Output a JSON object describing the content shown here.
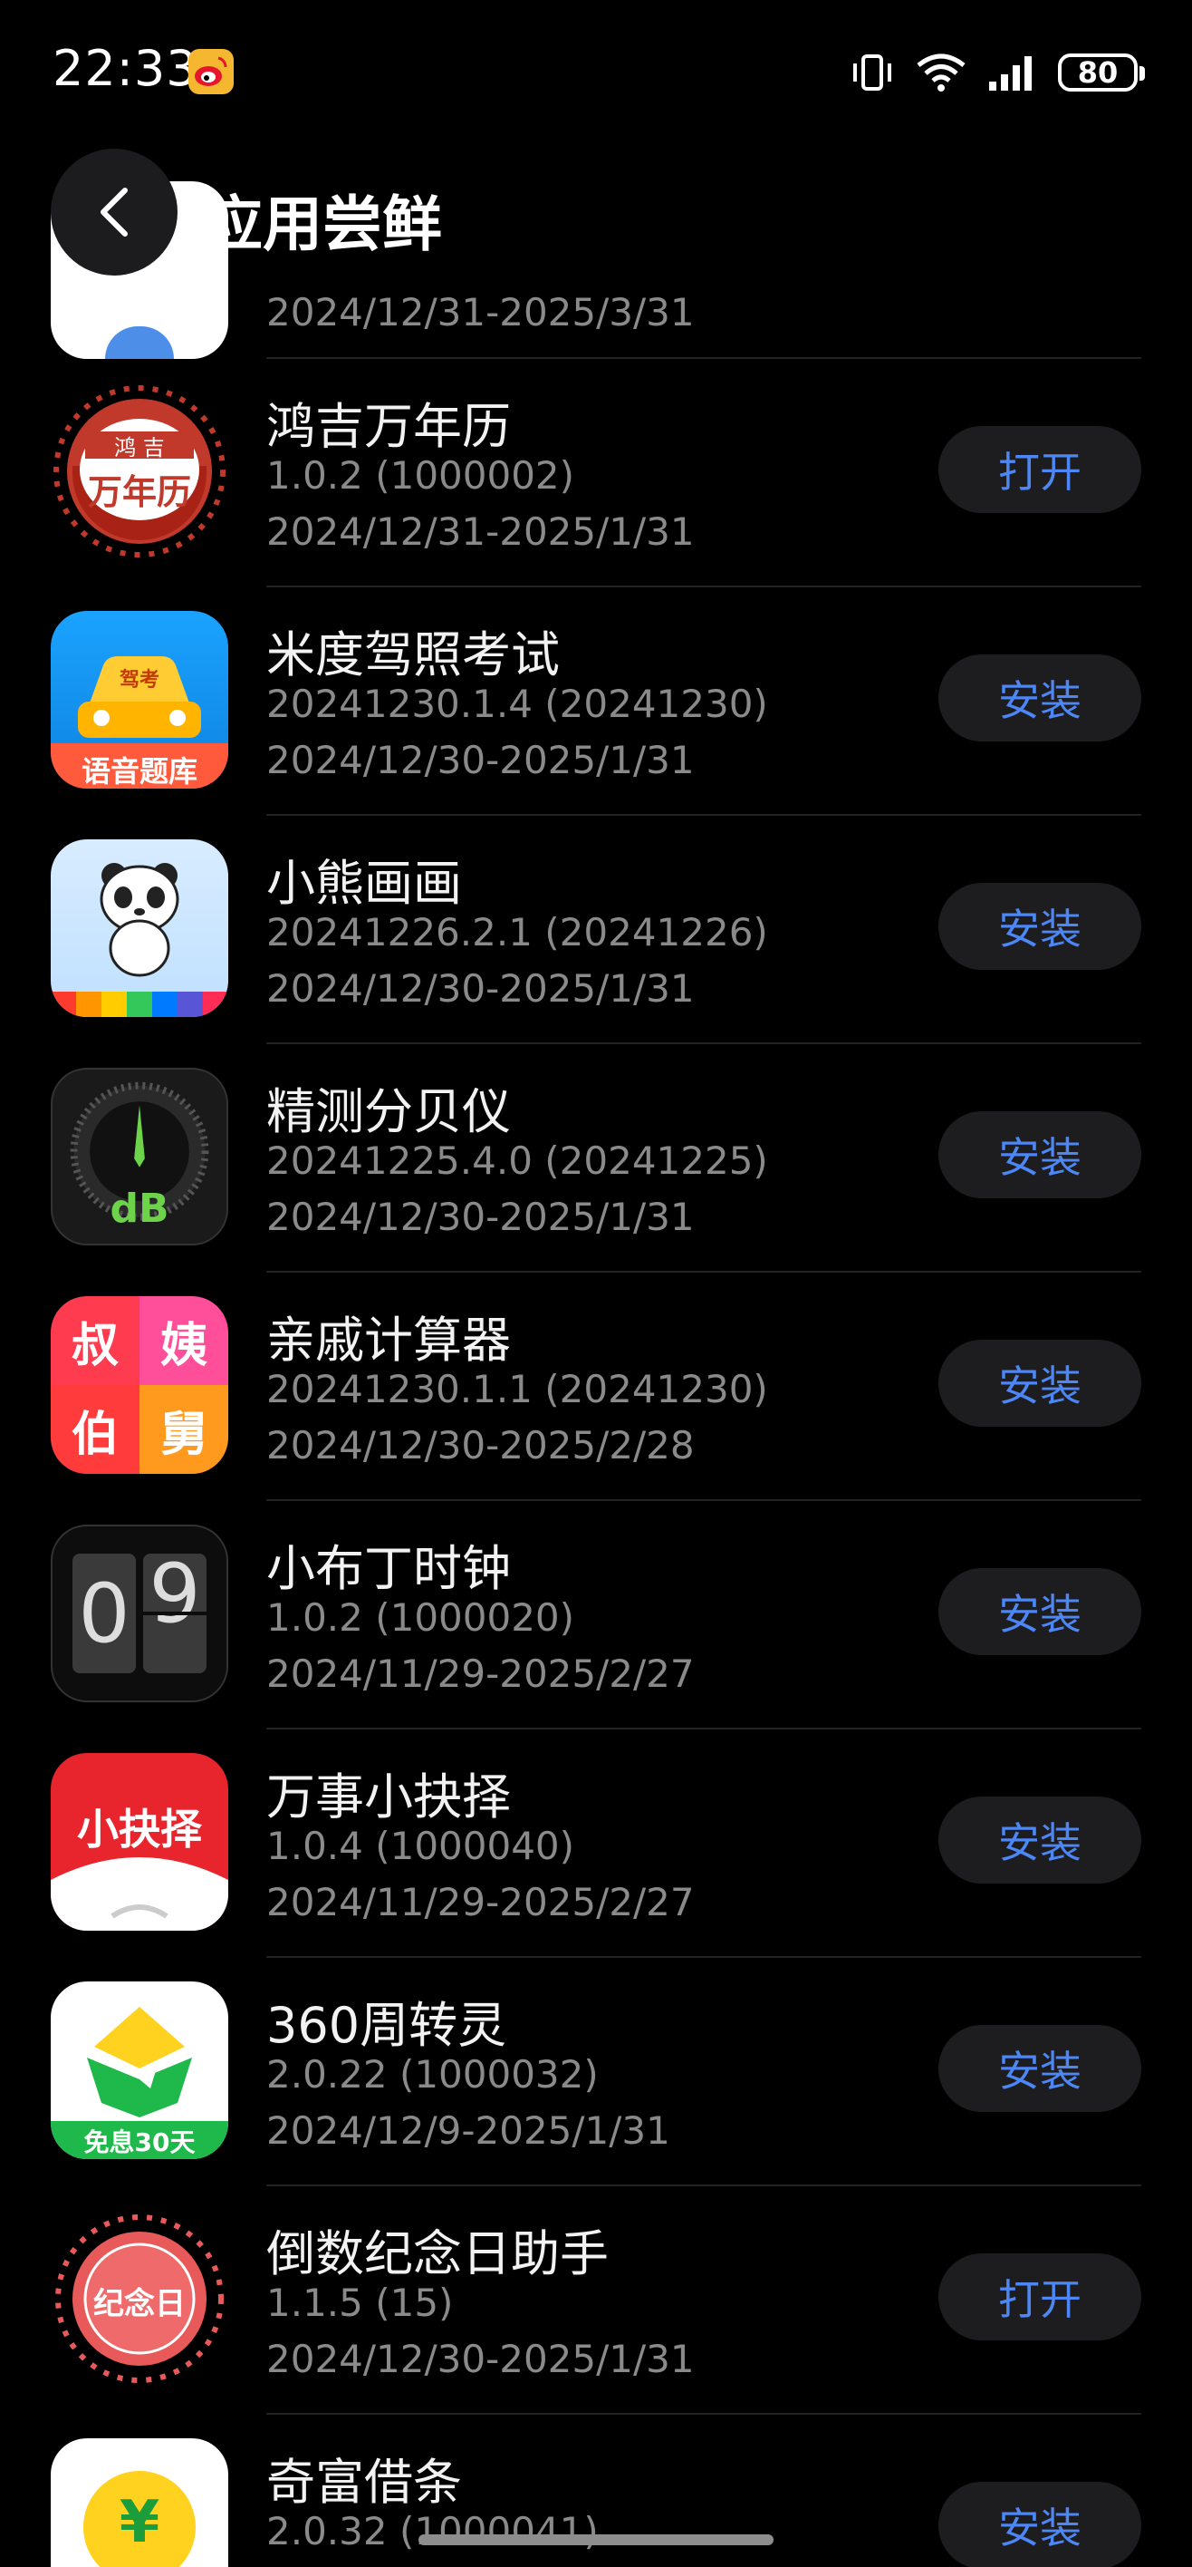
{
  "status_bar": {
    "time": "22:33",
    "battery": "80",
    "icons": [
      "weibo-icon",
      "vibrate-icon",
      "wifi-icon",
      "signal-icon",
      "battery-icon"
    ]
  },
  "header": {
    "title": "应用尝鲜",
    "back_icon": "chevron-left-icon"
  },
  "partial_top": {
    "dates": "2024/12/31-2025/3/31"
  },
  "apps": [
    {
      "name": "鸿吉万年历",
      "version": "1.0.2 (1000002)",
      "dates": "2024/12/31-2025/1/31",
      "action": "打开",
      "icon_text": "万年历",
      "icon_sub": "鸿 吉"
    },
    {
      "name": "米度驾照考试",
      "version": "20241230.1.4 (20241230)",
      "dates": "2024/12/30-2025/1/31",
      "action": "安装",
      "icon_text": "语音题库",
      "icon_sub": "驾考"
    },
    {
      "name": "小熊画画",
      "version": "20241226.2.1 (20241226)",
      "dates": "2024/12/30-2025/1/31",
      "action": "安装"
    },
    {
      "name": "精测分贝仪",
      "version": "20241225.4.0 (20241225)",
      "dates": "2024/12/30-2025/1/31",
      "action": "安装",
      "icon_text": "dB"
    },
    {
      "name": "亲戚计算器",
      "version": "20241230.1.1 (20241230)",
      "dates": "2024/12/30-2025/2/28",
      "action": "安装",
      "icon_tiles": [
        "叔",
        "姨",
        "伯",
        "舅"
      ]
    },
    {
      "name": "小布丁时钟",
      "version": "1.0.2 (1000020)",
      "dates": "2024/11/29-2025/2/27",
      "action": "安装",
      "icon_digits": [
        "0",
        "9"
      ]
    },
    {
      "name": "万事小抉择",
      "version": "1.0.4 (1000040)",
      "dates": "2024/11/29-2025/2/27",
      "action": "安装",
      "icon_text": "小抉择"
    },
    {
      "name": "360周转灵",
      "version": "2.0.22 (1000032)",
      "dates": "2024/12/9-2025/1/31",
      "action": "安装",
      "icon_text": "免息30天"
    },
    {
      "name": "倒数纪念日助手",
      "version": "1.1.5 (15)",
      "dates": "2024/12/30-2025/1/31",
      "action": "打开",
      "icon_text": "纪念日"
    },
    {
      "name": "奇富借条",
      "version": "2.0.32 (1000041)",
      "dates": "",
      "action": "安装",
      "icon_text": "¥"
    }
  ],
  "colors": {
    "background": "#000000",
    "button_bg": "#1d1d1f",
    "button_text": "#4d86f5",
    "secondary_text": "#8a8a8a"
  }
}
